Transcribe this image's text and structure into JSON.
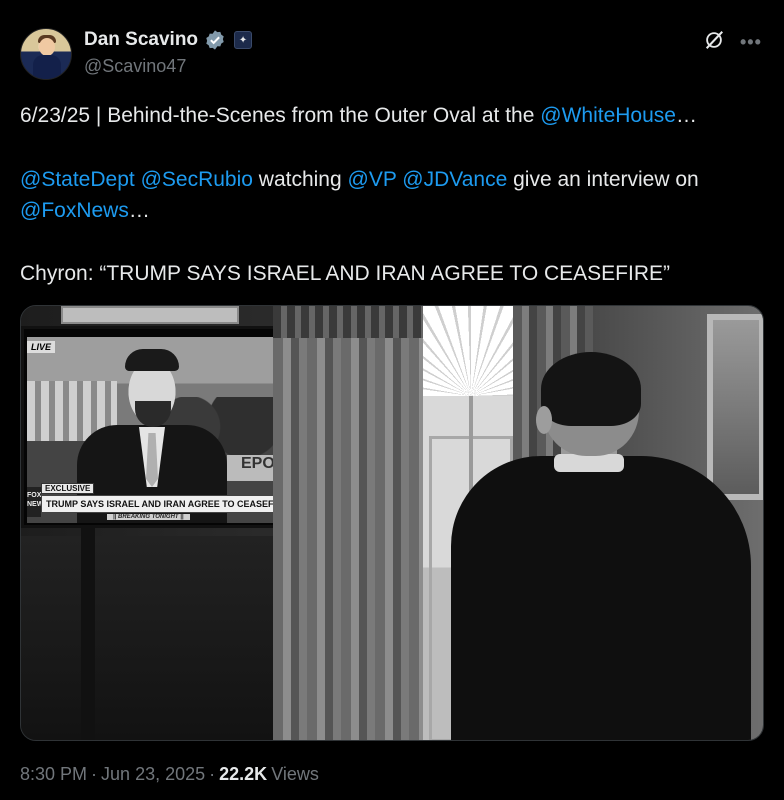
{
  "author": {
    "name": "Dan Scavino",
    "handle": "@Scavino47",
    "verified_badge_color": "#829aab"
  },
  "header_icons": [
    "grok-icon",
    "more-icon"
  ],
  "tweet": {
    "line1_text": "6/23/25 | Behind-the-Scenes from the Outer Oval at the ",
    "line1_mention": "@WhiteHouse",
    "line1_suffix": "…",
    "line2_mention1": "@StateDept",
    "line2_mention2": "@SecRubio",
    "line2_text1": " watching ",
    "line2_mention3": "@VP",
    "line2_mention4": "@JDVance",
    "line2_text2": " give an interview on",
    "line2_mention5": "@FoxNews",
    "line2_suffix": "…",
    "line3_text": "Chyron: “TRUMP SAYS ISRAEL AND IRAN AGREE TO CEASEFIRE”"
  },
  "photo": {
    "tv_live": "LIVE",
    "tv_exclusive": "EXCLUSIVE",
    "tv_chyron": "TRUMP SAYS ISRAEL AND IRAN AGREE TO CEASEFIRE",
    "tv_breaking": "|| BREAKING TONIGHT ||",
    "tv_report": "EPORT",
    "tv_network": "FOX NEWS"
  },
  "meta": {
    "time": "8:30 PM",
    "sep1": "·",
    "date": "Jun 23, 2025",
    "sep2": "·",
    "views_count": "22.2K",
    "views_label": "Views"
  },
  "colors": {
    "background": "#000000",
    "text": "#e7e9ea",
    "muted": "#71767b",
    "link": "#1d9bf0"
  }
}
